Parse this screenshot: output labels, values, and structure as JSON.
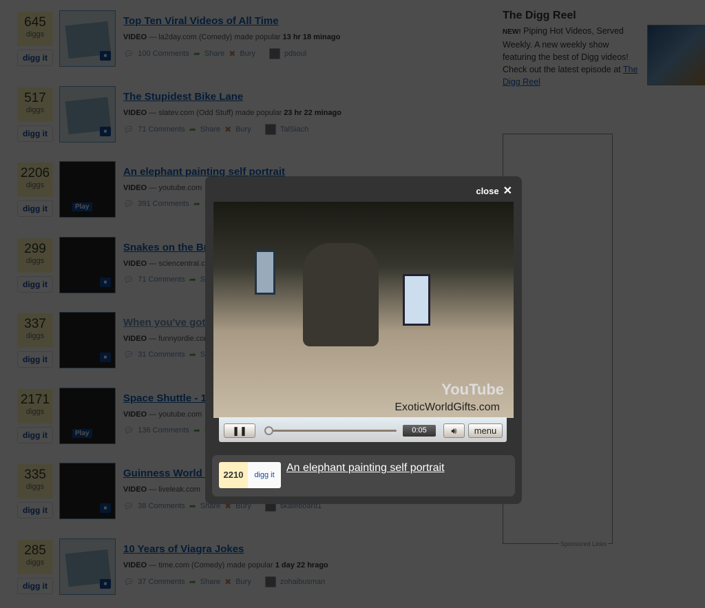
{
  "stories": [
    {
      "diggs": "645",
      "title": "Top Ten Viral Videos of All Time",
      "source": "la2day.com (Comedy)",
      "when": "13 hr 18 minago",
      "comments": "100 Comments",
      "user": "pdsoul",
      "thumb": "clapper"
    },
    {
      "diggs": "517",
      "title": "The Stupidest Bike Lane",
      "source": "slatev.com (Odd Stuff)",
      "when": "23 hr 22 minago",
      "comments": "71 Comments",
      "user": "TalSiach",
      "thumb": "clapper"
    },
    {
      "diggs": "2206",
      "title": "An elephant painting self portrait",
      "source": "youtube.com",
      "when": "",
      "comments": "391 Comments",
      "user": "",
      "thumb": "play"
    },
    {
      "diggs": "299",
      "title": "Snakes on the Br",
      "source": "sciencentral.c",
      "when": "",
      "comments": "71 Comments",
      "user": "",
      "thumb": "photo"
    },
    {
      "diggs": "337",
      "title": "When you've got",
      "source": "funnyordie.com",
      "when": "",
      "comments": "31 Comments",
      "user": "",
      "thumb": "photo",
      "visited": true
    },
    {
      "diggs": "2171",
      "title": "Space Shuttle - 1,",
      "source": "youtube.com",
      "when": "",
      "comments": "136 Comments",
      "user": "",
      "thumb": "play"
    },
    {
      "diggs": "335",
      "title": "Guinness World R",
      "source": "liveleak.com",
      "when": "",
      "comments": "38 Comments",
      "user": "skateboard1",
      "thumb": "photo"
    },
    {
      "diggs": "285",
      "title": "10 Years of Viagra Jokes",
      "source": "time.com (Comedy)",
      "when": "1 day 22 hrago",
      "comments": "37 Comments",
      "user": "zohaibusman",
      "thumb": "clapper"
    }
  ],
  "labels": {
    "diggs": "diggs",
    "digg_it": "digg it",
    "video": "VIDEO",
    "made_popular": "made popular",
    "share": "Share",
    "bury": "Bury",
    "play": "Play"
  },
  "sidebar": {
    "title": "The Digg Reel",
    "new": "NEW!",
    "text": "Piping Hot Videos, Served Weekly. A new weekly show featuring the best of Digg videos! Check out the latest episode at",
    "link": "The Digg Reel",
    "ad_label": "Sponsored Links"
  },
  "modal": {
    "close": "close",
    "time": "0:05",
    "menu": "menu",
    "watermark": "ExoticWorldGifts.com",
    "yt": "YouTube",
    "diggs": "2210",
    "digg_it": "digg it",
    "title": "An elephant painting self portrait",
    "progress": 0.01
  }
}
